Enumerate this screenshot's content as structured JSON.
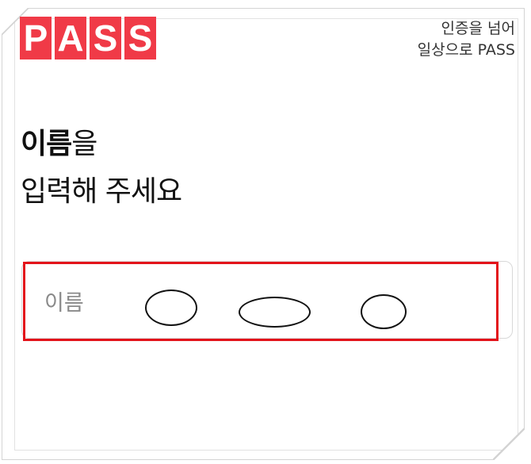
{
  "logo": {
    "letters": [
      "P",
      "A",
      "S",
      "S"
    ],
    "brand_color": "#f03a47"
  },
  "tagline": {
    "line1": "인증을 넘어",
    "line2": "일상으로 PASS"
  },
  "headline": {
    "bold": "이름",
    "rest_line1": "을",
    "line2": "입력해 주세요"
  },
  "name_field": {
    "label": "이름",
    "value_masked": true
  },
  "colors": {
    "highlight": "#e3131a",
    "text": "#111111",
    "label": "#8a8a8a"
  }
}
